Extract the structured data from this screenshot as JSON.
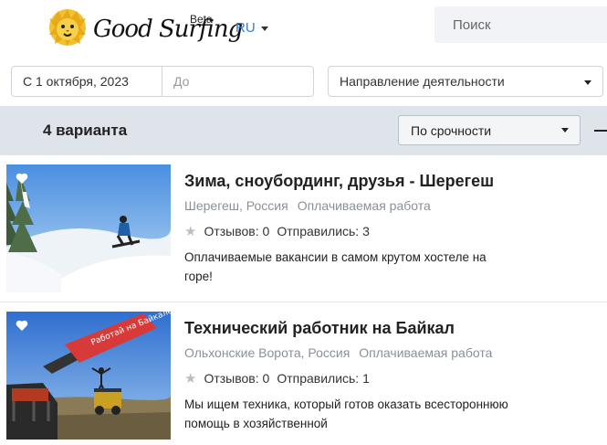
{
  "header": {
    "logo_text": "Good Surfing",
    "logo_badge": "Beta",
    "language": "RU",
    "search_placeholder": "Поиск"
  },
  "filters": {
    "date_from": "С 1 октября, 2023",
    "date_to_placeholder": "До",
    "direction": "Направление деятельности"
  },
  "results": {
    "count_label": "4 варианта",
    "sort_value": "По срочности"
  },
  "cards": [
    {
      "title": "Зима, сноубординг, друзья - Шерегеш",
      "location": "Шерегеш, Россия",
      "type": "Оплачиваемая работа",
      "reviews": "Отзывов: 0",
      "sent": "Отправились: 3",
      "description": "Оплачиваемые вакансии в самом крутом хостеле на горе!"
    },
    {
      "title": "Технический работник на Байкал",
      "location": "Ольхонские Ворота, Россия",
      "type": "Оплачиваемая работа",
      "reviews": "Отзывов: 0",
      "sent": "Отправились: 1",
      "description": "Мы ищем техника, который готов оказать всестороннюю помощь в хозяйственной",
      "image_banner_text": "Работай на Байкале"
    }
  ],
  "colors": {
    "accent": "#3a7bd5",
    "results_bar": "#dfe4ea",
    "muted_text": "#8a9098"
  },
  "icons": {
    "logo": "lion-logo-icon",
    "language_caret": "chevron-down-icon",
    "select_caret": "chevron-down-icon",
    "favorite": "heart-icon",
    "rating": "star-icon"
  }
}
